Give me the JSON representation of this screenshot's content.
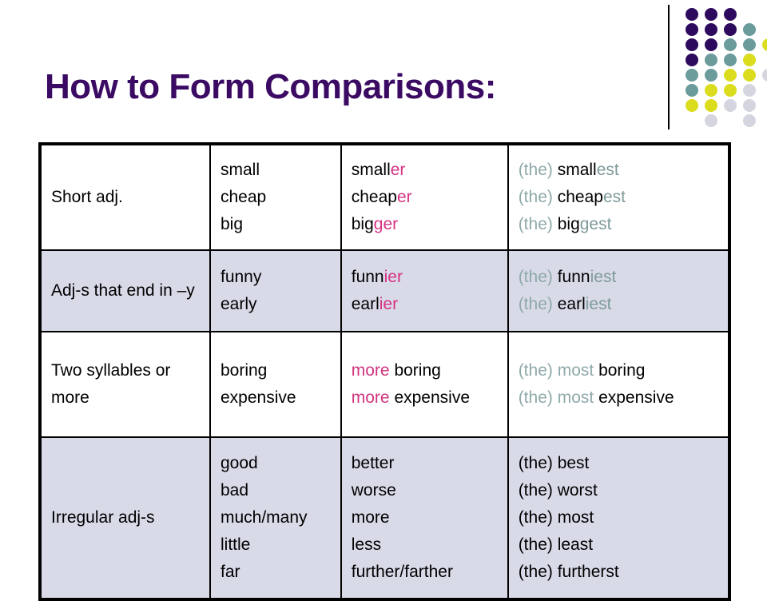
{
  "page": {
    "title": "How to Form Comparisons:"
  },
  "colors": {
    "title": "#3b0a63",
    "accent_pink": "#d0357f",
    "accent_teal": "#8fa9aa",
    "irregular_purple": "#3b0a63",
    "shaded_row_bg": "#d8dae8",
    "plain_row_bg": "#ffffff",
    "border": "#000000",
    "dot_purple": "#2d0a5e",
    "dot_teal": "#6b9b9b",
    "dot_yellow": "#dcdc1e",
    "dot_gray": "#d5d5e0"
  },
  "decoration": {
    "name": "dot-grid",
    "rows": [
      [
        "purple",
        "purple",
        "purple",
        null,
        null
      ],
      [
        "purple",
        "purple",
        "purple",
        "teal",
        null
      ],
      [
        "purple",
        "purple",
        "teal",
        "teal",
        "yellow"
      ],
      [
        "purple",
        "teal",
        "teal",
        "yellow",
        null
      ],
      [
        "teal",
        "teal",
        "yellow",
        "yellow",
        "gray"
      ],
      [
        "teal",
        "yellow",
        "yellow",
        "gray",
        null
      ],
      [
        "yellow",
        "yellow",
        "gray",
        "gray",
        null
      ],
      [
        null,
        "gray",
        null,
        "gray",
        null
      ]
    ]
  },
  "table": {
    "rows": [
      {
        "id": "short-adj",
        "shaded": false,
        "rule": "Short adj.",
        "base": [
          "small",
          "cheap",
          "big"
        ],
        "comparative": [
          {
            "stem": "small",
            "suffix": "er"
          },
          {
            "stem": "cheap",
            "suffix": "er"
          },
          {
            "stem": "big",
            "suffix": "ger"
          }
        ],
        "superlative": [
          {
            "the": "(the)",
            "stem": "small",
            "suffix": "est"
          },
          {
            "the": "(the)",
            "stem": "cheap",
            "suffix": "est"
          },
          {
            "the": "(the)",
            "stem": "big",
            "suffix": "gest"
          }
        ]
      },
      {
        "id": "adj-ending-y",
        "shaded": true,
        "rule": "Adj-s that end in –y",
        "base": [
          "funny",
          "early"
        ],
        "comparative": [
          {
            "stem": "funn",
            "suffix": "ier"
          },
          {
            "stem": "earl",
            "suffix": "ier"
          }
        ],
        "superlative": [
          {
            "the": "(the)",
            "stem": "funn",
            "suffix": "iest"
          },
          {
            "the": "(the)",
            "stem": "earl",
            "suffix": "iest"
          }
        ]
      },
      {
        "id": "two-syllables",
        "shaded": false,
        "rule": "Two syllables or more",
        "base": [
          "boring",
          "expensive"
        ],
        "comparative": [
          {
            "prefix": "more",
            "stem": "boring"
          },
          {
            "prefix": "more",
            "stem": "expensive"
          }
        ],
        "superlative": [
          {
            "the": "(the)",
            "most": "most",
            "stem": "boring"
          },
          {
            "the": "(the)",
            "most": "most",
            "stem": "expensive"
          }
        ]
      },
      {
        "id": "irregular",
        "shaded": true,
        "rule": "Irregular adj-s",
        "base": [
          "good",
          "bad",
          "much/many",
          "little",
          "far"
        ],
        "comparative": [
          {
            "stem": "better"
          },
          {
            "stem": "worse"
          },
          {
            "stem": "more"
          },
          {
            "stem": "less"
          },
          {
            "stem": "further/farther"
          }
        ],
        "superlative": [
          {
            "whole": "(the) best"
          },
          {
            "whole": "(the) worst"
          },
          {
            "whole": "(the) most"
          },
          {
            "whole": "(the) least"
          },
          {
            "whole": "(the) furtherst"
          }
        ]
      }
    ]
  }
}
